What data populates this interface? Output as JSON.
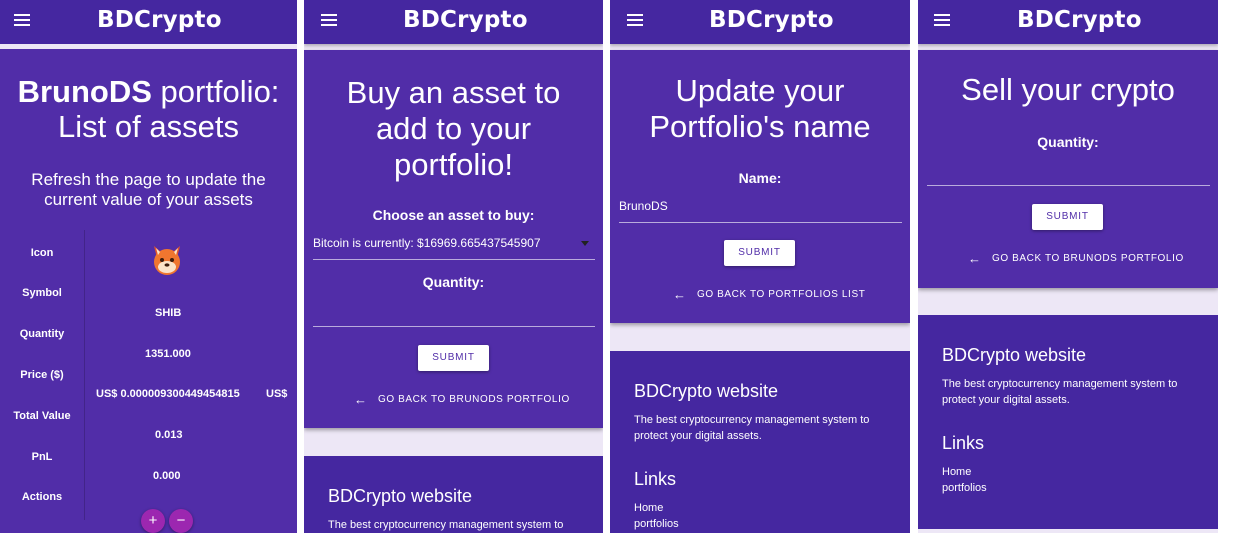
{
  "brand": "BDCrypto",
  "colors": {
    "primary": "#512da8",
    "appbar": "#4527a0",
    "action_button": "#9c27b0"
  },
  "screen1": {
    "title_bold": "BrunoDS",
    "title_rest": " portfolio:",
    "title_line2": "List of assets",
    "subtitle_line1": "Refresh the page to update the",
    "subtitle_line2": "current value of your assets",
    "labels": {
      "icon": "Icon",
      "symbol": "Symbol",
      "quantity": "Quantity",
      "price": "Price ($)",
      "total": "Total Value",
      "pnl": "PnL",
      "actions": "Actions"
    },
    "asset": {
      "icon": "shiba-inu-icon",
      "symbol": "SHIB",
      "quantity": "1351.000",
      "price": "US$ 0.000009300449454815",
      "price_suffix": "US$",
      "total": "0.013",
      "pnl": "0.000"
    },
    "actions": {
      "add": "+",
      "remove": "−"
    }
  },
  "screen2": {
    "title_line1": "Buy an asset to",
    "title_line2": "add to your",
    "title_line3": "portfolio!",
    "choose_label": "Choose an asset to buy:",
    "asset_select": "Bitcoin is currently: $16969.665437545907",
    "quantity_label": "Quantity:",
    "submit": "SUBMIT",
    "back": "GO BACK TO BRUNODS PORTFOLIO",
    "footer_title": "BDCrypto website",
    "footer_text": "The best cryptocurrency management system to"
  },
  "screen3": {
    "title_line1": "Update your",
    "title_line2": "Portfolio's name",
    "name_label": "Name:",
    "name_value": "BrunoDS",
    "submit": "SUBMIT",
    "back": "GO BACK TO PORTFOLIOS LIST",
    "footer_title": "BDCrypto website",
    "footer_text1": "The best cryptocurrency management system to",
    "footer_text2": "protect your digital assets.",
    "links_title": "Links",
    "link_home": "Home",
    "link_portfolios": "portfolios"
  },
  "screen4": {
    "title": "Sell your crypto",
    "quantity_label": "Quantity:",
    "submit": "SUBMIT",
    "back": "GO BACK TO BRUNODS PORTFOLIO",
    "footer_title": "BDCrypto website",
    "footer_text1": "The best cryptocurrency management system to",
    "footer_text2": "protect your digital assets.",
    "links_title": "Links",
    "link_home": "Home",
    "link_portfolios": "portfolios"
  }
}
